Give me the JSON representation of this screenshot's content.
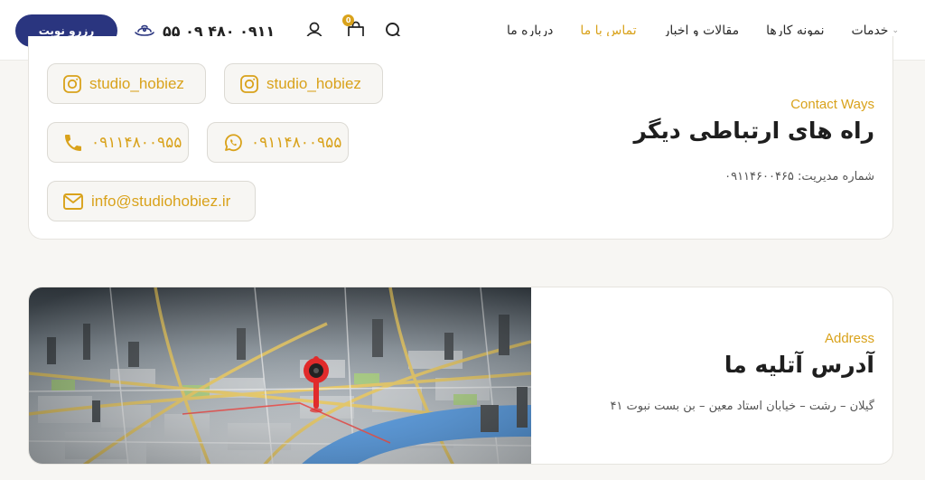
{
  "header": {
    "nav": [
      {
        "label": "خدمات",
        "has_dropdown": true,
        "active": false
      },
      {
        "label": "نمونه کارها",
        "active": false
      },
      {
        "label": "مقالات و اخبار",
        "active": false
      },
      {
        "label": "تماس با ما",
        "active": true
      },
      {
        "label": "درباره ما",
        "active": false
      }
    ],
    "phone": "۰۹۱۱ ۴۸۰ ۰۹ ۵۵",
    "reserve_label": "رزرو نوبت",
    "cart_count": "0"
  },
  "contact": {
    "kicker": "Contact Ways",
    "title": "راه های ارتباطی دیگر",
    "manager_phone": "شماره مدیریت: ۰۹۱۱۴۶۰۰۴۶۵",
    "links": {
      "instagram_1": "studio_hobiez",
      "instagram_2": "studio_hobiez",
      "whatsapp": "۰۹۱۱۴۸۰۰۹۵۵",
      "phone": "۰۹۱۱۴۸۰۰۹۵۵",
      "email": "info@studiohobiez.ir"
    }
  },
  "address": {
    "kicker": "Address",
    "title": "آدرس آتلیه ما",
    "text": "گیلان – رشت – خیابان استاد معین – بن بست نبوت ۴۱"
  },
  "colors": {
    "accent": "#d9a21b",
    "brand": "#2a357f",
    "background": "#f7f6f3"
  },
  "icons": [
    "search-icon",
    "cart-icon",
    "user-icon",
    "phone-hand-icon",
    "instagram-icon",
    "whatsapp-icon",
    "phone-icon",
    "email-icon",
    "map-pin-icon"
  ]
}
